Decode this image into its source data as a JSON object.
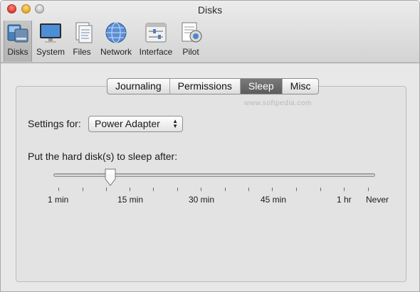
{
  "window": {
    "title": "Disks"
  },
  "toolbar": {
    "items": [
      {
        "label": "Disks",
        "icon": "disks-icon"
      },
      {
        "label": "System",
        "icon": "monitor-icon"
      },
      {
        "label": "Files",
        "icon": "files-icon"
      },
      {
        "label": "Network",
        "icon": "globe-icon"
      },
      {
        "label": "Interface",
        "icon": "interface-icon"
      },
      {
        "label": "Pilot",
        "icon": "pilot-icon"
      }
    ],
    "selected": "Disks"
  },
  "tabs": {
    "items": [
      "Journaling",
      "Permissions",
      "Sleep",
      "Misc"
    ],
    "active": "Sleep"
  },
  "settings": {
    "label": "Settings for:",
    "selected_value": "Power Adapter"
  },
  "sleep": {
    "label": "Put the hard disk(s) to sleep after:",
    "slider_position_fraction": 0.167,
    "tick_labels": [
      "1 min",
      "15 min",
      "30 min",
      "45 min",
      "1 hr",
      "Never"
    ]
  },
  "watermark": {
    "text": "www.softpedia.com"
  }
}
